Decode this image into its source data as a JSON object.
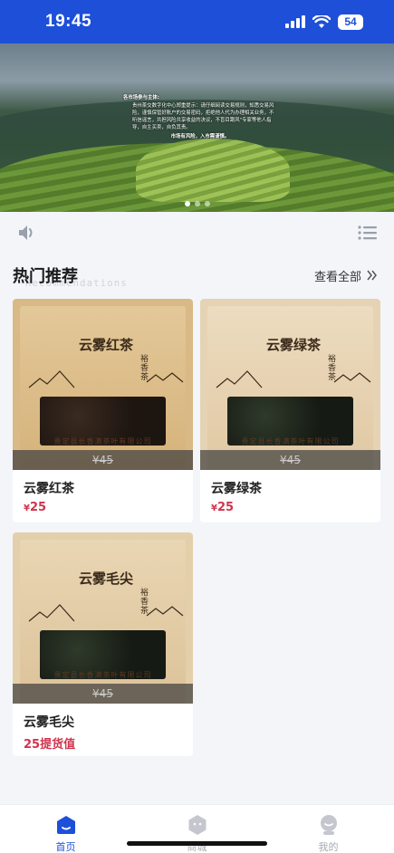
{
  "status_bar": {
    "time": "19:45",
    "battery": "54"
  },
  "banner": {
    "announcement_title": "各市场参与主体:",
    "announcement_body": "贵州茶交数字化中心郑重提示：请仔细阅读交易规则，知悉交易风险，谨慎保管好账户的交易密码，拒绝他人代为办理相关业务，不听信谣言，共担风险共享收益的决议，不盲目跟风\"专家等他人指导，自主买卖，自负其责。",
    "announcement_footer": "市场有风险，入市需谨慎。",
    "slide_count": 3,
    "active_slide": 0
  },
  "section": {
    "title": "热门推荐",
    "subtitle": "Recommendations",
    "see_all": "查看全部"
  },
  "products": [
    {
      "name": "云雾红茶",
      "price_symbol": "¥",
      "price": "25",
      "original_price": "¥45",
      "package_label": "云雾红茶",
      "package_sub": "裕香茶",
      "company": "贵定县长香满茶叶有限公司"
    },
    {
      "name": "云雾绿茶",
      "price_symbol": "¥",
      "price": "25",
      "original_price": "¥45",
      "package_label": "云雾绿茶",
      "package_sub": "裕香茶",
      "company": "贵定县长香满茶叶有限公司"
    },
    {
      "name": "云雾毛尖",
      "price": "25提货值",
      "original_price": "¥45",
      "package_label": "云雾毛尖",
      "package_sub": "裕香茶",
      "company": "贵定县长香满茶叶有限公司"
    }
  ],
  "nav": [
    {
      "label": "首页",
      "icon": "home-icon",
      "active": true
    },
    {
      "label": "商城",
      "icon": "shop-icon",
      "active": false
    },
    {
      "label": "我的",
      "icon": "profile-icon",
      "active": false
    }
  ],
  "colors": {
    "primary": "#1d4fd9",
    "price": "#d0344d",
    "background": "#f3f5f9"
  }
}
